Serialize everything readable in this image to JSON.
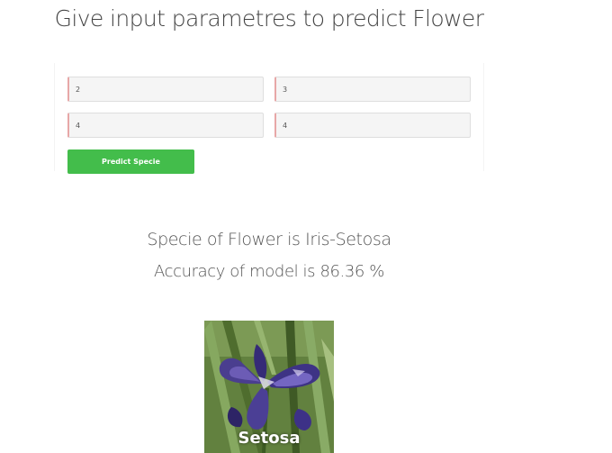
{
  "header": {
    "title": "Give input parametres to predict Flower"
  },
  "form": {
    "inputs": [
      {
        "value": "2"
      },
      {
        "value": "3"
      },
      {
        "value": "4"
      },
      {
        "value": "4"
      }
    ],
    "submit_label": "Predict Specie"
  },
  "result": {
    "species_text": "Specie of Flower is Iris-Setosa",
    "accuracy_text": "Accuracy of model is 86.36 %"
  },
  "image": {
    "caption": "Setosa"
  },
  "colors": {
    "button": "#43bd4b",
    "input_background": "#f5f5f5",
    "input_accent": "#e7a7a7"
  }
}
